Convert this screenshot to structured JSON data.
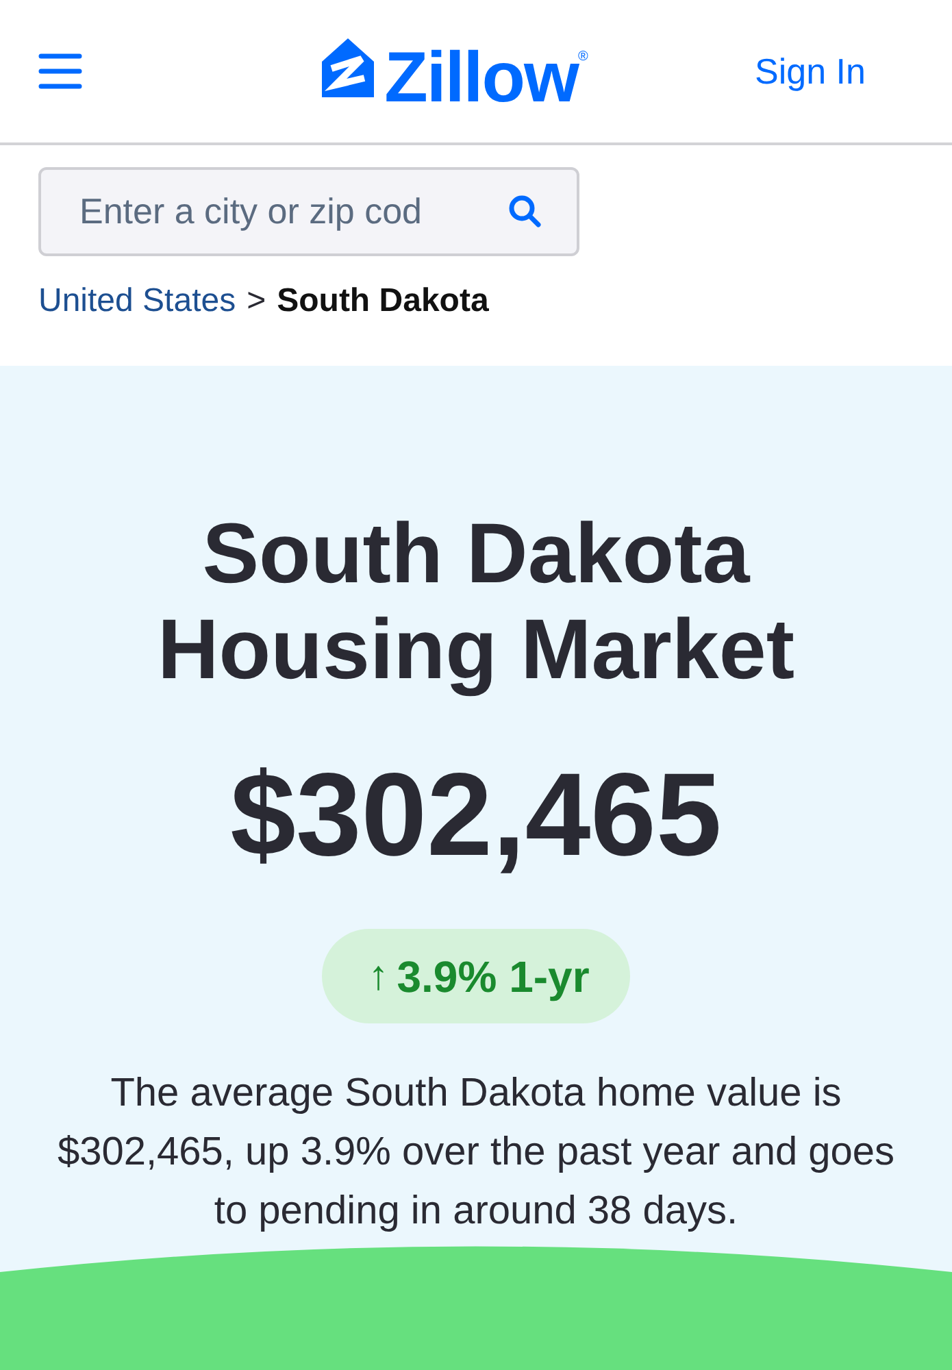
{
  "header": {
    "logo": "Zillow$^{®}$",
    "sign_in": "Sign In"
  },
  "search": {
    "placeholder": "Enter a city or zip cod"
  },
  "breadcrumb": {
    "separator": ">",
    "items": [
      {
        "label": "United States",
        "current": false
      },
      {
        "label": "South Dakota",
        "current": true
      }
    ]
  },
  "hero": {
    "title": "South Dakota Housing Market",
    "price": "$302,465",
    "change": {
      "arrow": "↑",
      "text": "3.9% 1-yr"
    },
    "summary": "The average South Dakota home value is $302,465, up 3.9% over the past year and goes to pending in around 38 days."
  }
}
